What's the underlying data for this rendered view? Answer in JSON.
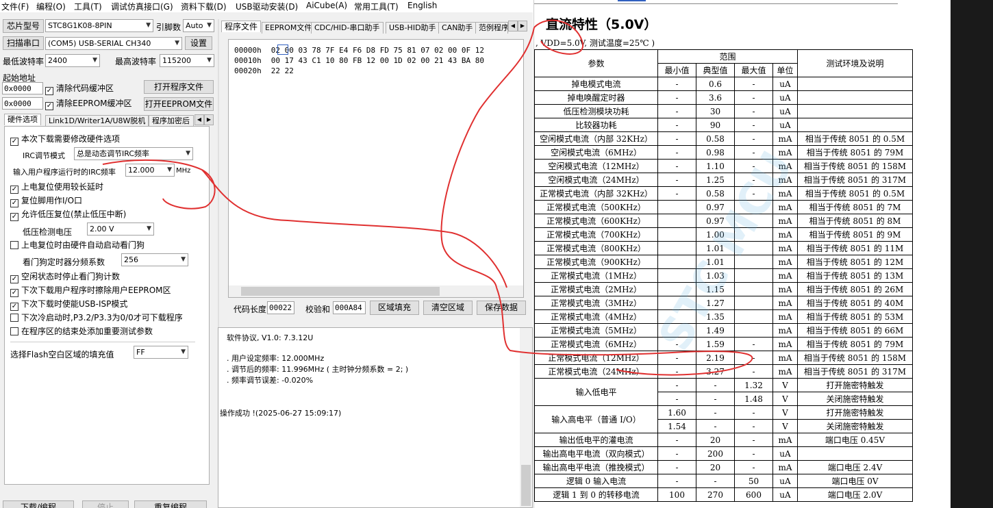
{
  "menu": [
    "文件(F)",
    "编程(O)",
    "工具(T)",
    "调试仿真接口(G)",
    "资料下载(D)",
    "USB驱动安装(D)",
    "AiCube(A)",
    "常用工具(T)",
    "English"
  ],
  "left": {
    "chip_btn": "芯片型号",
    "chip_value": "STC8G1K08-8PIN",
    "pins_label": "引脚数",
    "pins_value": "Auto",
    "scan_btn": "扫描串口",
    "port_value": "(COM5) USB-SERIAL CH340",
    "settings_btn": "设置",
    "min_baud_label": "最低波特率",
    "min_baud": "2400",
    "max_baud_label": "最高波特率",
    "max_baud": "115200",
    "start_addr_label": "起始地址",
    "addr1": "0x0000",
    "clear_code_buf": "清除代码缓冲区",
    "open_prog_btn": "打开程序文件",
    "addr2": "0x0000",
    "clear_eeprom_buf": "清除EEPROM缓冲区",
    "open_eeprom_btn": "打开EEPROM文件",
    "tabs": [
      "硬件选项",
      "Link1D/Writer1A/U8W脱机",
      "程序加密后"
    ],
    "opt_modify_hw": "本次下载需要修改硬件选项",
    "irc_mode_label": "IRC调节模式",
    "irc_mode_value": "总是动态调节IRC频率",
    "irc_freq_label": "输入用户程序运行时的IRC频率",
    "irc_freq_value": "12.000",
    "irc_freq_unit": "MHz",
    "opts": [
      "上电复位使用较长延时",
      "复位脚用作I/O口",
      "允许低压复位(禁止低压中断)"
    ],
    "lvd_label": "低压检测电压",
    "lvd_value": "2.00 V",
    "wdt_auto": "上电复位时由硬件自动启动看门狗",
    "wdt_div_label": "看门狗定时器分频系数",
    "wdt_div_value": "256",
    "opts2": [
      "空闲状态时停止看门狗计数",
      "下次下载用户程序时擦除用户EEPROM区",
      "下次下载时使能USB-ISP模式"
    ],
    "opts3": [
      "下次冷启动时,P3.2/P3.3为0/0才可下载程序",
      "在程序区的结束处添加重要测试参数"
    ],
    "fill_label": "选择Flash空白区域的填充值",
    "fill_value": "FF",
    "bottom_btns": [
      "下载/编程",
      "停止",
      "重复编程"
    ]
  },
  "mid": {
    "tabs": [
      "程序文件",
      "EEPROM文件",
      "CDC/HID-串口助手",
      "USB-HID助手",
      "CAN助手",
      "范例程序"
    ],
    "hex_rows": [
      {
        "addr": "00000h",
        "bytes": "02 00 03 78 7F E4 F6 D8 FD 75 81 07 02 00 0F 12"
      },
      {
        "addr": "00010h",
        "bytes": "00 17 43 C1 10 80 FB 12 00 1D 02 00 21 43 BA 80"
      },
      {
        "addr": "00020h",
        "bytes": "22 22"
      }
    ],
    "code_len_label": "代码长度",
    "code_len": "00022",
    "checksum_label": "校验和",
    "checksum": "000A84",
    "fill_btn": "区域填充",
    "clear_btn": "清空区域",
    "save_btn": "保存数据",
    "log": [
      "软件协议, V1.0: 7.3.12U",
      "",
      ". 用户设定频率: 12.000MHz",
      ". 调节后的频率: 11.996MHz ( 主时钟分频系数 = 2; )",
      ". 频率调节误差: -0.020%",
      "",
      "",
      "操作成功 !(2025-06-27 15:09:17)"
    ]
  },
  "doc": {
    "title": "直流特性（5.0V）",
    "cond": ", VDD=5.0V, 测试温度=25℃ )",
    "h_param": "参数",
    "h_range": "范围",
    "h_min": "最小值",
    "h_typ": "典型值",
    "h_max": "最大值",
    "h_unit": "单位",
    "h_env": "测试环境及说明",
    "rows": [
      [
        "掉电模式电流",
        "-",
        "0.6",
        "-",
        "uA",
        ""
      ],
      [
        "掉电唤醒定时器",
        "-",
        "3.6",
        "-",
        "uA",
        ""
      ],
      [
        "低压检测模块功耗",
        "-",
        "30",
        "-",
        "uA",
        ""
      ],
      [
        "比较器功耗",
        "-",
        "90",
        "-",
        "uA",
        ""
      ],
      [
        "空闲模式电流（内部 32KHz）",
        "-",
        "0.58",
        "-",
        "mA",
        "相当于传统 8051 的 0.5M"
      ],
      [
        "空闲模式电流（6MHz）",
        "-",
        "0.98",
        "-",
        "mA",
        "相当于传统 8051 的 79M"
      ],
      [
        "空闲模式电流（12MHz）",
        "-",
        "1.10",
        "-",
        "mA",
        "相当于传统 8051 的 158M"
      ],
      [
        "空闲模式电流（24MHz）",
        "-",
        "1.25",
        "-",
        "mA",
        "相当于传统 8051 的 317M"
      ],
      [
        "正常模式电流（内部 32KHz）",
        "-",
        "0.58",
        "-",
        "mA",
        "相当于传统 8051 的 0.5M"
      ],
      [
        "正常模式电流（500KHz）",
        "",
        "0.97",
        "",
        "mA",
        "相当于传统 8051 的 7M"
      ],
      [
        "正常模式电流（600KHz）",
        "",
        "0.97",
        "",
        "mA",
        "相当于传统 8051 的 8M"
      ],
      [
        "正常模式电流（700KHz）",
        "",
        "1.00",
        "",
        "mA",
        "相当于传统 8051 的 9M"
      ],
      [
        "正常模式电流（800KHz）",
        "",
        "1.01",
        "",
        "mA",
        "相当于传统 8051 的 11M"
      ],
      [
        "正常模式电流（900KHz）",
        "",
        "1.01",
        "",
        "mA",
        "相当于传统 8051 的 12M"
      ],
      [
        "正常模式电流（1MHz）",
        "",
        "1.03",
        "",
        "mA",
        "相当于传统 8051 的 13M"
      ],
      [
        "正常模式电流（2MHz）",
        "",
        "1.15",
        "",
        "mA",
        "相当于传统 8051 的 26M"
      ],
      [
        "正常模式电流（3MHz）",
        "",
        "1.27",
        "",
        "mA",
        "相当于传统 8051 的 40M"
      ],
      [
        "正常模式电流（4MHz）",
        "",
        "1.35",
        "",
        "mA",
        "相当于传统 8051 的 53M"
      ],
      [
        "正常模式电流（5MHz）",
        "",
        "1.49",
        "",
        "mA",
        "相当于传统 8051 的 66M"
      ],
      [
        "正常模式电流（6MHz）",
        "-",
        "1.59",
        "-",
        "mA",
        "相当于传统 8051 的 79M"
      ],
      [
        "正常模式电流（12MHz）",
        "-",
        "2.19",
        "-",
        "mA",
        "相当于传统 8051 的 158M"
      ],
      [
        "正常模式电流（24MHz）",
        "-",
        "3.27",
        "-",
        "mA",
        "相当于传统 8051 的 317M"
      ]
    ],
    "vil_label": "输入低电平",
    "vil_rows": [
      [
        "-",
        "-",
        "1.32",
        "V",
        "打开施密特触发"
      ],
      [
        "-",
        "-",
        "1.48",
        "V",
        "关闭施密特触发"
      ]
    ],
    "vih_label": "输入高电平（普通 I/O）",
    "vih_rows": [
      [
        "1.60",
        "-",
        "-",
        "V",
        "打开施密特触发"
      ],
      [
        "1.54",
        "-",
        "-",
        "V",
        "关闭施密特触发"
      ]
    ],
    "rows2": [
      [
        "输出低电平的灌电流",
        "-",
        "20",
        "-",
        "mA",
        "端口电压 0.45V"
      ],
      [
        "输出高电平电流（双向模式）",
        "-",
        "200",
        "-",
        "uA",
        ""
      ],
      [
        "输出高电平电流（推挽模式）",
        "-",
        "20",
        "-",
        "mA",
        "端口电压 2.4V"
      ],
      [
        "逻辑 0 输入电流",
        "-",
        "-",
        "50",
        "uA",
        "端口电压 0V"
      ],
      [
        "逻辑 1 到 0 的转移电流",
        "100",
        "270",
        "600",
        "uA",
        "端口电压 2.0V"
      ]
    ],
    "watermark": "STC MCU"
  },
  "colors": {
    "annotation": "#e03030",
    "window_bg": "#f0f0f0"
  }
}
